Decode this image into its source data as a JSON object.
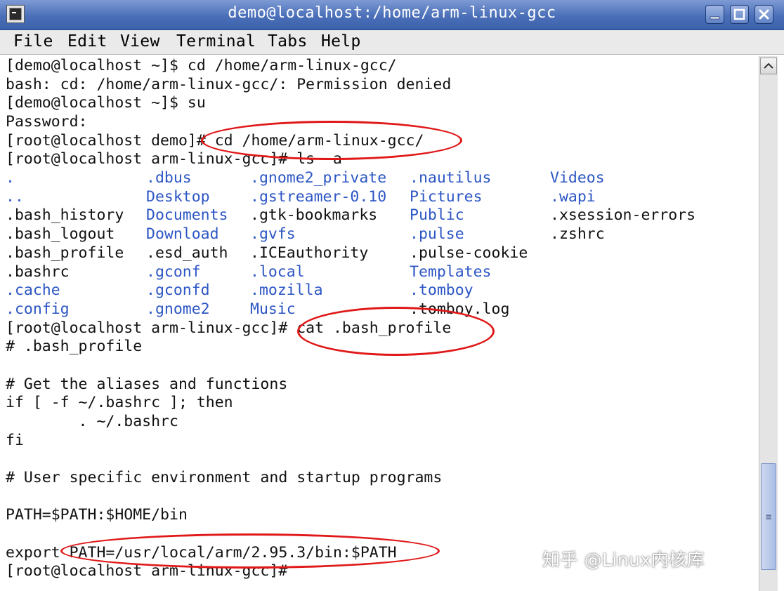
{
  "window": {
    "title": "demo@localhost:/home/arm-linux-gcc"
  },
  "menu": [
    "File",
    "Edit",
    "View",
    "Terminal",
    "Tabs",
    "Help"
  ],
  "terminal": {
    "lines_top": [
      "[demo@localhost ~]$ cd /home/arm-linux-gcc/",
      "bash: cd: /home/arm-linux-gcc/: Permission denied",
      "[demo@localhost ~]$ su",
      "Password:",
      "[root@localhost demo]# cd /home/arm-linux-gcc/",
      "[root@localhost arm-linux-gcc]# ls -a"
    ],
    "listing": [
      [
        {
          "t": ".",
          "c": "dir"
        },
        {
          "t": ".dbus",
          "c": "dir"
        },
        {
          "t": ".gnome2_private",
          "c": "dir"
        },
        {
          "t": ".nautilus",
          "c": "dir"
        },
        {
          "t": "Videos",
          "c": "dir"
        }
      ],
      [
        {
          "t": "..",
          "c": "dir"
        },
        {
          "t": "Desktop",
          "c": "dir"
        },
        {
          "t": ".gstreamer-0.10",
          "c": "dir"
        },
        {
          "t": "Pictures",
          "c": "dir"
        },
        {
          "t": ".wapi",
          "c": "dir"
        }
      ],
      [
        {
          "t": ".bash_history",
          "c": "file"
        },
        {
          "t": "Documents",
          "c": "dir"
        },
        {
          "t": ".gtk-bookmarks",
          "c": "file"
        },
        {
          "t": "Public",
          "c": "dir"
        },
        {
          "t": ".xsession-errors",
          "c": "file"
        }
      ],
      [
        {
          "t": ".bash_logout",
          "c": "file"
        },
        {
          "t": "Download",
          "c": "dir"
        },
        {
          "t": ".gvfs",
          "c": "dir"
        },
        {
          "t": ".pulse",
          "c": "dir"
        },
        {
          "t": ".zshrc",
          "c": "file"
        }
      ],
      [
        {
          "t": ".bash_profile",
          "c": "file"
        },
        {
          "t": ".esd_auth",
          "c": "file"
        },
        {
          "t": ".ICEauthority",
          "c": "file"
        },
        {
          "t": ".pulse-cookie",
          "c": "file"
        },
        {
          "t": "",
          "c": "file"
        }
      ],
      [
        {
          "t": ".bashrc",
          "c": "file"
        },
        {
          "t": ".gconf",
          "c": "dir"
        },
        {
          "t": ".local",
          "c": "dir"
        },
        {
          "t": "Templates",
          "c": "dir"
        },
        {
          "t": "",
          "c": "file"
        }
      ],
      [
        {
          "t": ".cache",
          "c": "dir"
        },
        {
          "t": ".gconfd",
          "c": "dir"
        },
        {
          "t": ".mozilla",
          "c": "dir"
        },
        {
          "t": ".tomboy",
          "c": "dir"
        },
        {
          "t": "",
          "c": "file"
        }
      ],
      [
        {
          "t": ".config",
          "c": "dir"
        },
        {
          "t": ".gnome2",
          "c": "dir"
        },
        {
          "t": "Music",
          "c": "dir"
        },
        {
          "t": ".tomboy.log",
          "c": "file"
        },
        {
          "t": "",
          "c": "file"
        }
      ]
    ],
    "lines_bottom": [
      "[root@localhost arm-linux-gcc]# cat .bash_profile",
      "# .bash_profile",
      "",
      "# Get the aliases and functions",
      "if [ -f ~/.bashrc ]; then",
      "        . ~/.bashrc",
      "fi",
      "",
      "# User specific environment and startup programs",
      "",
      "PATH=$PATH:$HOME/bin",
      "",
      "export PATH=/usr/local/arm/2.95.3/bin:$PATH",
      "[root@localhost arm-linux-gcc]#"
    ]
  },
  "colors": {
    "directory": "#2c56c4",
    "annotation": "#e01818",
    "titlebar": "#4a6fb8"
  },
  "watermark": "知乎 @Linux内核库"
}
